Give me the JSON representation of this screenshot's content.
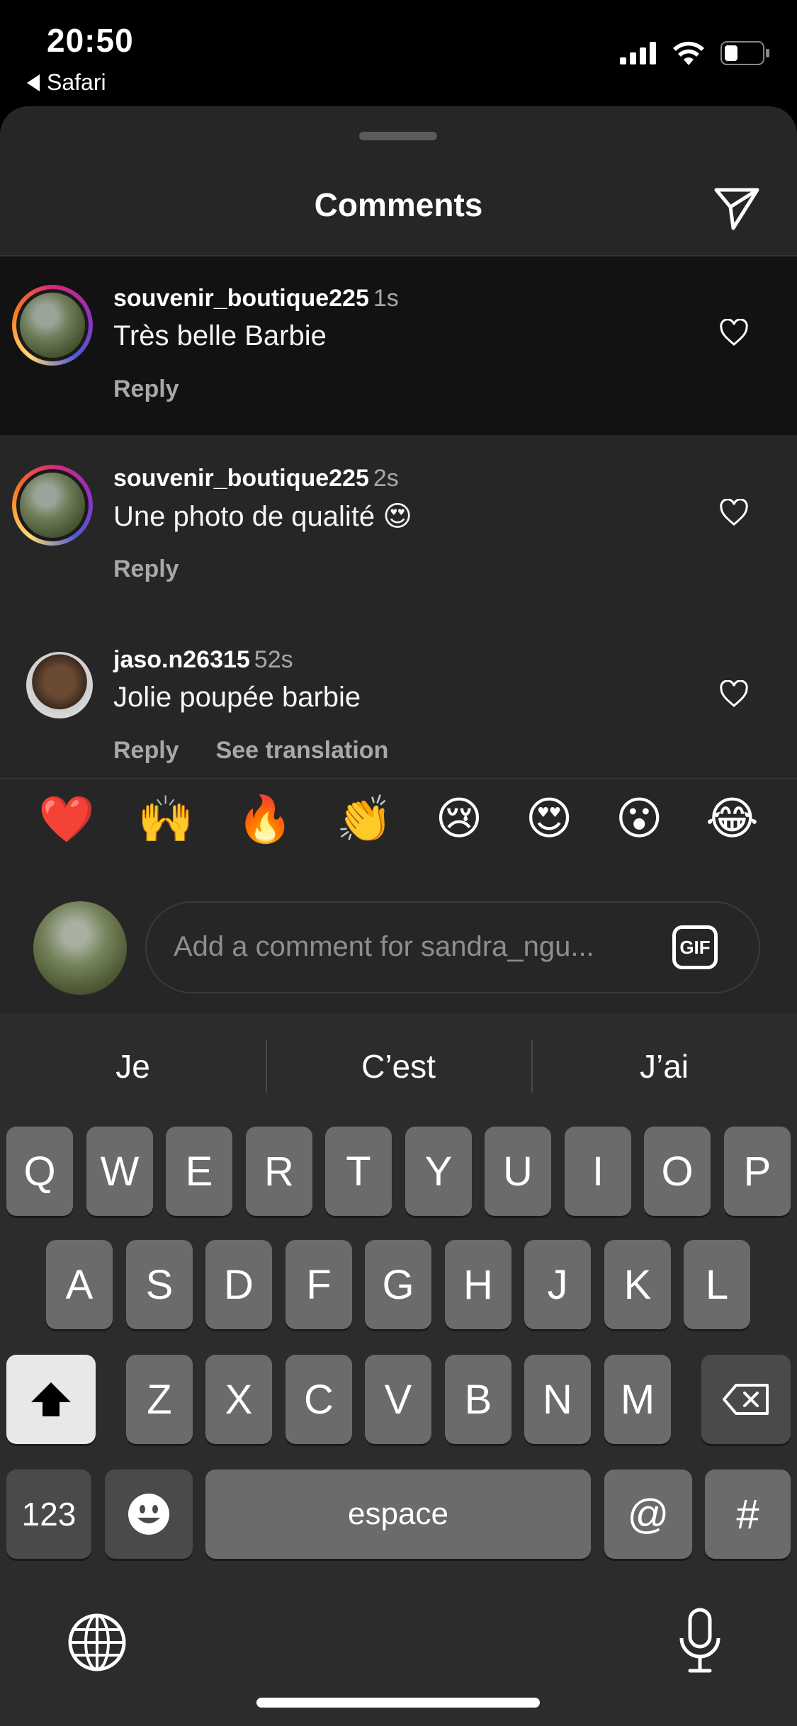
{
  "status": {
    "time": "20:50",
    "back_label": "Safari"
  },
  "sheet": {
    "title": "Comments"
  },
  "comments": [
    {
      "username": "souvenir_boutique225",
      "time": "1s",
      "text": "Très belle Barbie",
      "reply": "Reply",
      "translation": ""
    },
    {
      "username": "souvenir_boutique225",
      "time": "2s",
      "text": "Une photo de qualité 😍",
      "reply": "Reply",
      "translation": ""
    },
    {
      "username": "jaso.n26315",
      "time": "52s",
      "text": "Jolie poupée barbie",
      "reply": "Reply",
      "translation": "See translation"
    }
  ],
  "quick_emojis": [
    "❤️",
    "🙌",
    "🔥",
    "👏",
    "😢",
    "😍",
    "😮",
    "😂"
  ],
  "composer": {
    "placeholder": "Add a comment for sandra_ngu...",
    "gif_label": "GIF"
  },
  "keyboard": {
    "predictions": [
      "Je",
      "C’est",
      "J’ai"
    ],
    "row1": [
      "Q",
      "W",
      "E",
      "R",
      "T",
      "Y",
      "U",
      "I",
      "O",
      "P"
    ],
    "row2": [
      "A",
      "S",
      "D",
      "F",
      "G",
      "H",
      "J",
      "K",
      "L"
    ],
    "row3": [
      "Z",
      "X",
      "C",
      "V",
      "B",
      "N",
      "M"
    ],
    "numbers_label": "123",
    "space_label": "espace",
    "at_label": "@",
    "hash_label": "#"
  }
}
